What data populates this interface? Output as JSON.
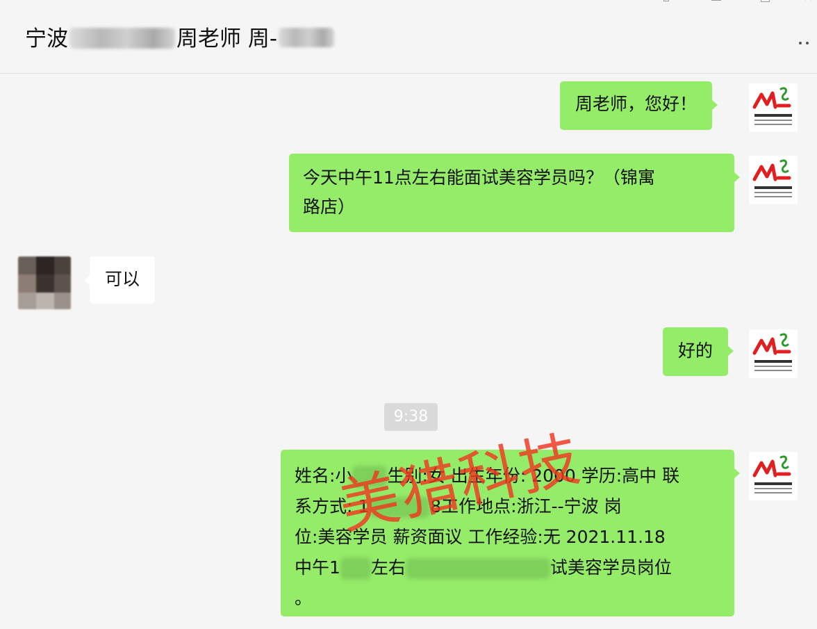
{
  "window": {
    "title_part1": "宁波",
    "title_part2": "周老师 周-"
  },
  "messages": [
    {
      "side": "out",
      "text": "周老师，您好！"
    },
    {
      "side": "out",
      "line1": "今天中午11点左右能面试美容学员吗？（锦寓",
      "line2": "路店）"
    },
    {
      "side": "in",
      "text": "可以"
    },
    {
      "side": "out",
      "text": "好的"
    },
    {
      "side": "out",
      "l1": "姓名:小",
      "l1b": "生别:女 出生年份: 2000 学历:高中 联",
      "l2": "系方式: 1",
      "l2b": "8工作地点:浙江--宁波 岗",
      "l3": "位:美容学员 薪资面议 工作经验:无 2021.11.18",
      "l4": "中午1",
      "l4b": "左右",
      "l4c": "试美容学员岗位",
      "l5": "。"
    }
  ],
  "timestamp": "9:38",
  "watermark": "美猎科技",
  "colors": {
    "outgoing_bubble": "#95ec69",
    "incoming_bubble": "#ffffff",
    "watermark": "#ee3820"
  }
}
